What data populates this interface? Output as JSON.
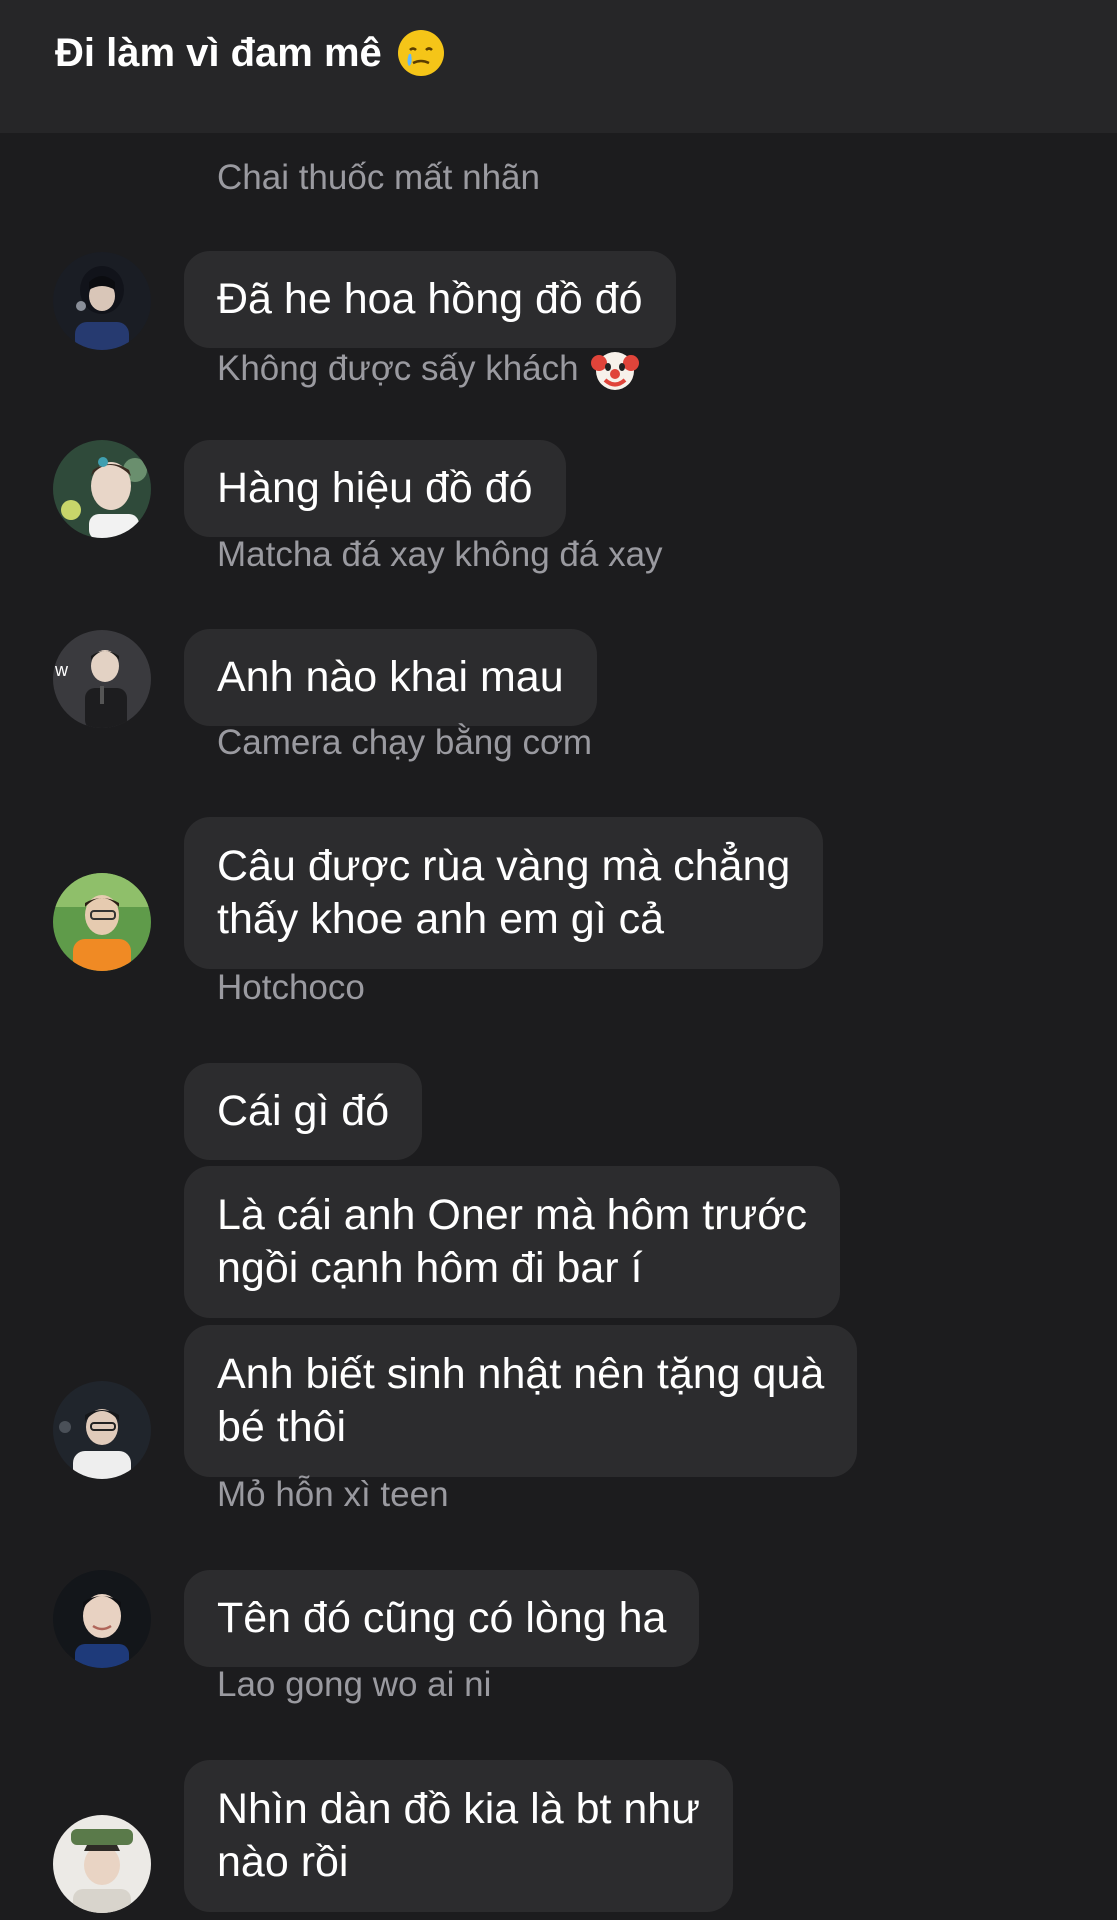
{
  "header": {
    "title": "Đi làm vì đam mê",
    "title_emoji": "sad-tear-face-icon"
  },
  "messages": [
    {
      "sender": "Chai thuốc mất nhãn",
      "lines": [
        "Đã he hoa hồng đồ đó"
      ]
    },
    {
      "sender": "Không được sấy khách",
      "sender_emoji": "clown-face-icon",
      "lines": [
        "Hàng hiệu đồ đó"
      ]
    },
    {
      "sender": "Matcha đá xay không đá xay",
      "lines": [
        "Anh nào khai mau"
      ]
    },
    {
      "sender": "Camera chạy bằng cơm",
      "lines": [
        "Câu được rùa vàng mà chẳng",
        "thấy khoe anh em gì cả"
      ]
    },
    {
      "sender": "Hotchoco",
      "lines": [
        "Cái gì đó"
      ]
    },
    {
      "sender": "",
      "lines": [
        "Là cái anh Oner mà hôm trước",
        "ngồi cạnh hôm đi bar í"
      ]
    },
    {
      "sender": "",
      "lines": [
        "Anh biết sinh nhật nên tặng quà",
        "bé thôi"
      ]
    },
    {
      "sender": "Mỏ hỗn xì teen",
      "lines": [
        "Tên đó cũng có lòng ha"
      ]
    },
    {
      "sender": "Lao gong wo ai ni",
      "lines": [
        "Nhìn dàn đồ kia là bt như",
        "nào rồi"
      ]
    }
  ],
  "colors": {
    "background": "#1c1c1e",
    "header": "#262628",
    "bubble": "#2c2c2e",
    "sender_text": "#9a9aa0",
    "message_text": "#ffffff"
  }
}
